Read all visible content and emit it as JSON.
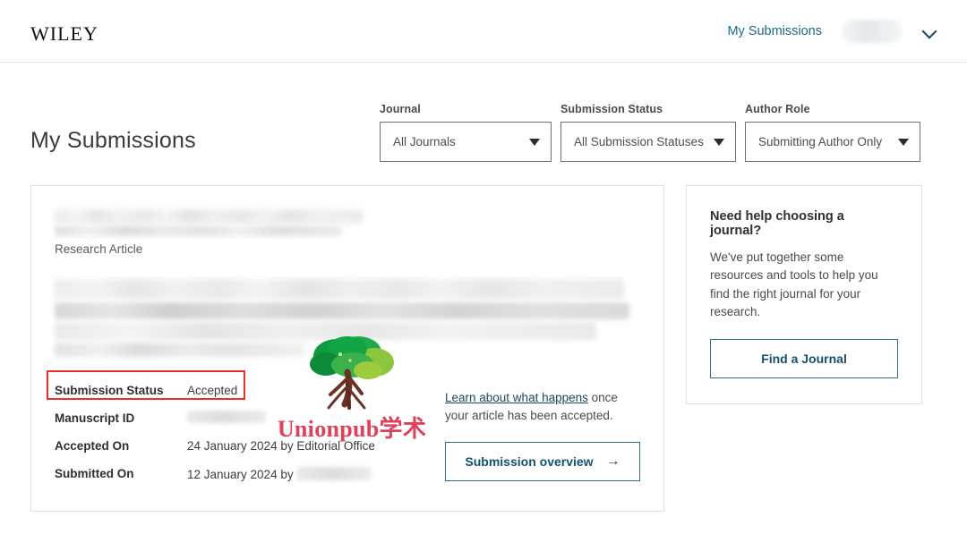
{
  "header": {
    "logo_text": "Wiley",
    "my_submissions_link": "My Submissions",
    "account_name_redacted": "",
    "chevron_icon": "chevron-down-icon"
  },
  "page": {
    "title": "My Submissions"
  },
  "filters": [
    {
      "label": "Journal",
      "value": "All Journals",
      "icon": "caret-down-icon"
    },
    {
      "label": "Submission Status",
      "value": "All Submission Statuses",
      "icon": "caret-down-icon"
    },
    {
      "label": "Author Role",
      "value": "Submitting Author Only",
      "icon": "caret-down-icon"
    }
  ],
  "submission": {
    "title_redacted": "",
    "article_type": "Research Article",
    "abstract_redacted": "",
    "meta": [
      {
        "key": "Submission Status",
        "value": "Accepted",
        "redacted": false
      },
      {
        "key": "Manuscript ID",
        "value": "",
        "redacted": true
      },
      {
        "key": "Accepted On",
        "value": "24 January 2024 by Editorial Office",
        "redacted": false
      },
      {
        "key": "Submitted On",
        "value": "12 January 2024 by",
        "redacted": true
      }
    ],
    "highlight_color": "#e8302a",
    "learn_link_text": "Learn about what happens",
    "learn_rest_text": " once your article has been accepted.",
    "overview_button": "Submission overview",
    "overview_arrow": "→"
  },
  "help_card": {
    "title": "Need help choosing a journal?",
    "text": "We've put together some resources and tools to help you find the right journal for your research.",
    "button": "Find a Journal"
  },
  "watermark": {
    "text": "Unionpub学术",
    "logo_icon": "tree-logo-icon",
    "color": "#e0405a"
  },
  "colors": {
    "link": "#1a6a8a",
    "button_border": "#2f7085",
    "button_text": "#12526b",
    "highlight": "#e8302a"
  }
}
